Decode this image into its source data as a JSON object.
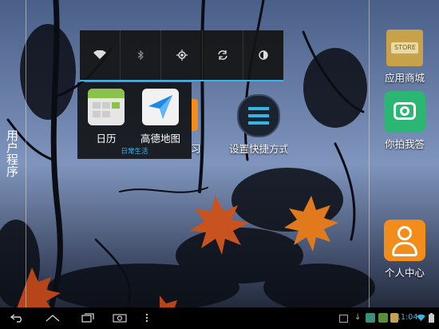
{
  "left_sidebar": {
    "label": "用户程序"
  },
  "quick_settings": {
    "toggles": [
      {
        "icon": "wifi-icon"
      },
      {
        "icon": "bluetooth-icon"
      },
      {
        "icon": "gps-icon"
      },
      {
        "icon": "sync-icon"
      },
      {
        "icon": "brightness-icon"
      }
    ]
  },
  "folder": {
    "name": "日常生活",
    "apps": [
      {
        "label": "日历",
        "icon": "calendar-icon"
      },
      {
        "label": "高德地图",
        "icon": "map-navigation-icon"
      }
    ]
  },
  "desktop": {
    "partial_app_label": "习",
    "settings_shortcut_label": "设置快捷方式"
  },
  "right_sidebar": {
    "apps": [
      {
        "label": "应用商城",
        "icon": "app-store-icon"
      },
      {
        "label": "你拍我答",
        "icon": "camera-icon"
      },
      {
        "label": "个人中心",
        "icon": "user-profile-icon"
      }
    ]
  },
  "navbar": {
    "buttons": [
      "back-icon",
      "home-icon",
      "recent-apps-icon",
      "screenshot-icon",
      "menu-icon"
    ],
    "time": "11:04"
  },
  "colors": {
    "accent": "#33b5e5",
    "store": "#c8a24a",
    "camera": "#2bb673",
    "profile": "#f28c1a"
  }
}
